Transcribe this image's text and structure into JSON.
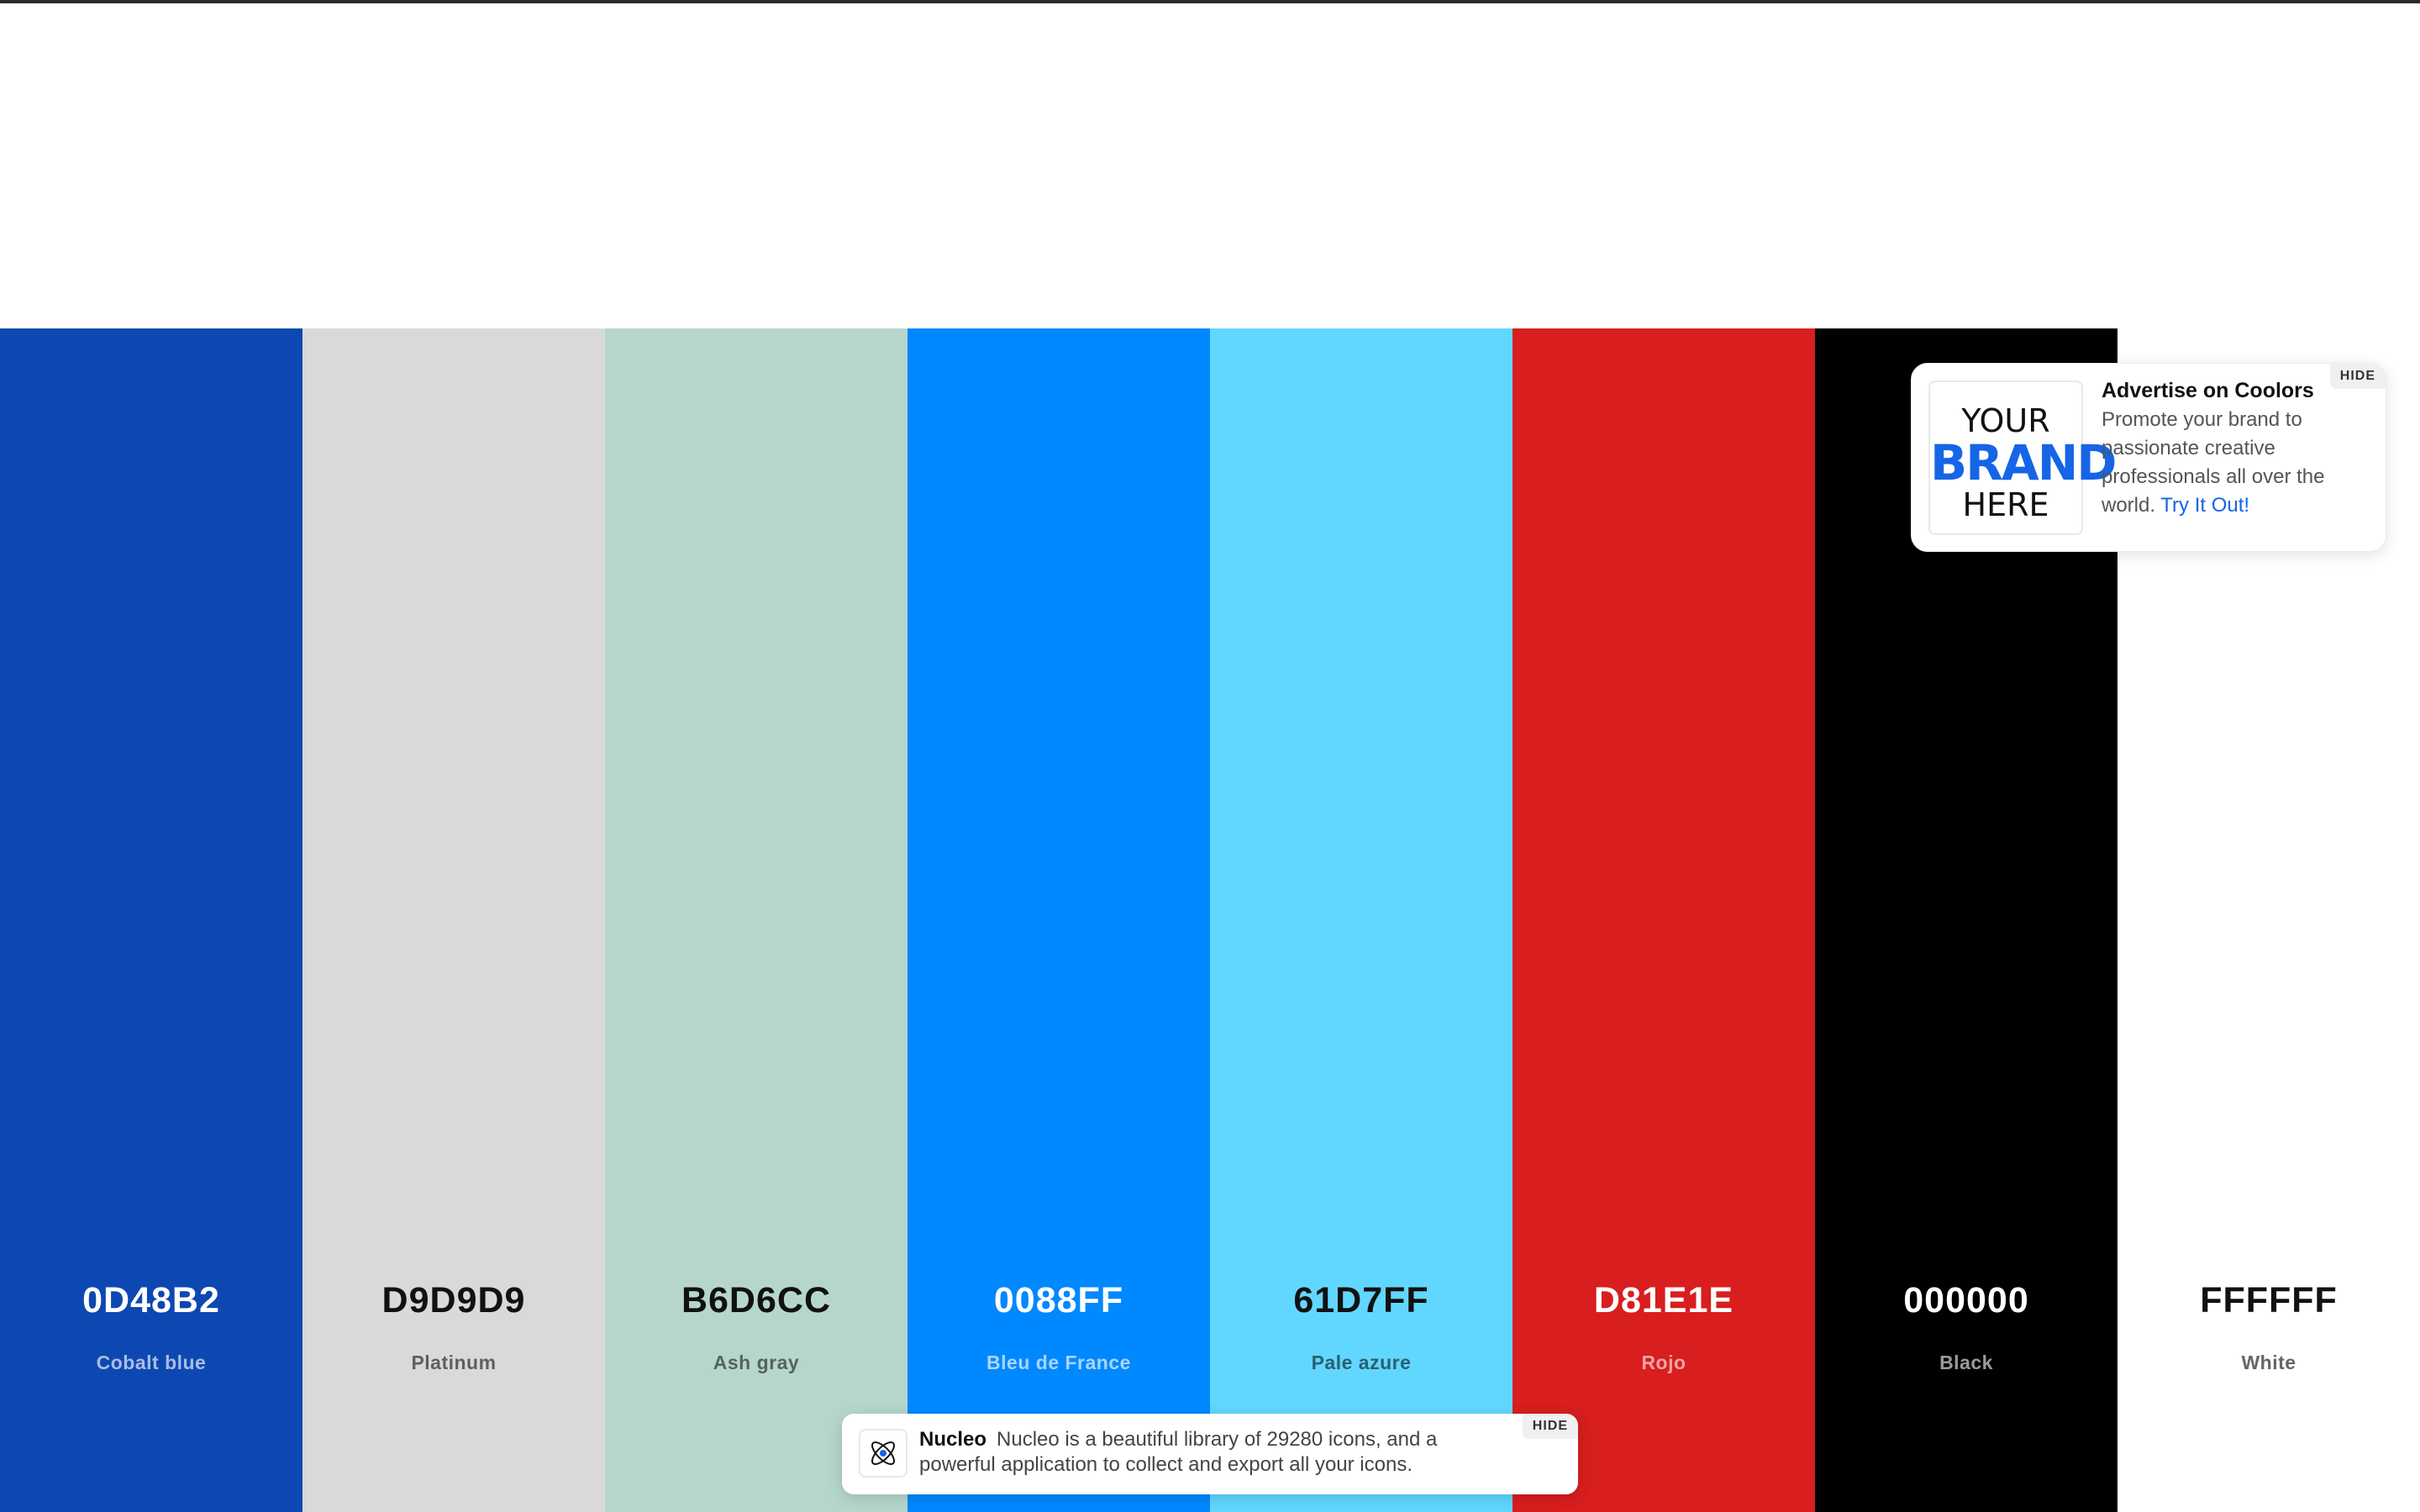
{
  "palette": {
    "colors": [
      {
        "hex": "0D48B2",
        "name": "Cobalt blue",
        "bg": "#0D48B2",
        "hex_color": "#ffffff",
        "name_color": "#a9bde3"
      },
      {
        "hex": "D9D9D9",
        "name": "Platinum",
        "bg": "#D9D9D9",
        "hex_color": "#111111",
        "name_color": "#5f5f5f"
      },
      {
        "hex": "B6D6CC",
        "name": "Ash gray",
        "bg": "#B6D6CC",
        "hex_color": "#111111",
        "name_color": "#55635e"
      },
      {
        "hex": "0088FF",
        "name": "Bleu de France",
        "bg": "#0088FF",
        "hex_color": "#ffffff",
        "name_color": "#a9d5ff"
      },
      {
        "hex": "61D7FF",
        "name": "Pale azure",
        "bg": "#61D7FF",
        "hex_color": "#111111",
        "name_color": "#2b5f70"
      },
      {
        "hex": "D81E1E",
        "name": "Rojo",
        "bg": "#D81E1E",
        "hex_color": "#ffffff",
        "name_color": "#f0a5a5"
      },
      {
        "hex": "000000",
        "name": "Black",
        "bg": "#000000",
        "hex_color": "#ffffff",
        "name_color": "#9a9a9a"
      },
      {
        "hex": "FFFFFF",
        "name": "White",
        "bg": "#FFFFFF",
        "hex_color": "#111111",
        "name_color": "#666666"
      }
    ]
  },
  "ad": {
    "logo_line1": "YOUR",
    "logo_line2": "BRAND",
    "logo_line3": "HERE",
    "title": "Advertise on Coolors",
    "body": "Promote your brand to passionate creative professionals all over the world.",
    "link_label": "Try It Out!",
    "hide_label": "HIDE",
    "accent_color": "#1565e6"
  },
  "notice": {
    "icon": "nucleo-atom-icon",
    "brand": "Nucleo",
    "text": "Nucleo is a beautiful library of 29280 icons, and a powerful application to collect and export all your icons.",
    "hide_label": "HIDE"
  }
}
